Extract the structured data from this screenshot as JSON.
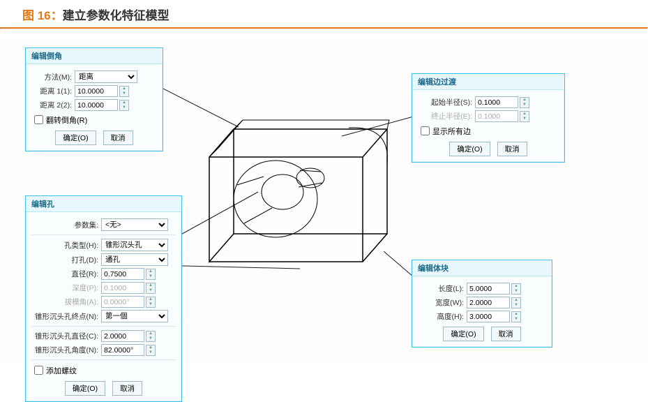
{
  "caption_prefix": "图 16：",
  "caption_text": "建立参数化特征模型",
  "chamfer": {
    "title": "编辑倒角",
    "method_label": "方法(M):",
    "method_value": "距离",
    "dist1_label": "距离 1(1):",
    "dist1_value": "10.0000",
    "dist2_label": "距离 2(2):",
    "dist2_value": "10.0000",
    "flip_label": "翻转倒角(R)",
    "ok": "确定(O)",
    "cancel": "取消"
  },
  "hole": {
    "title": "编辑孔",
    "paramset_label": "参数集:",
    "paramset_value": "<无>",
    "type_label": "孔类型(H):",
    "type_value": "锥形沉头孔",
    "drill_label": "打孔(D):",
    "drill_value": "通孔",
    "dia_label": "直径(R):",
    "dia_value": "0.7500",
    "depth_label": "深度(P):",
    "depth_value": "0.1000",
    "draft_label": "拔模角(A):",
    "draft_value": "0.0000°",
    "end_label": "锥形沉头孔终点(N):",
    "end_value": "第一個",
    "csk_dia_label": "锥形沉头孔直径(C):",
    "csk_dia_value": "2.0000",
    "csk_ang_label": "锥形沉头孔角度(N):",
    "csk_ang_value": "82.0000°",
    "thread_label": "添加螺纹",
    "ok": "确定(O)",
    "cancel": "取消"
  },
  "blend": {
    "title": "编辑边过渡",
    "start_label": "起始半径(S):",
    "start_value": "0.1000",
    "end_label": "终止半径(E):",
    "end_value": "0.1000",
    "all_label": "显示所有边",
    "ok": "确定(O)",
    "cancel": "取消"
  },
  "block": {
    "title": "编辑体块",
    "len_label": "长度(L):",
    "len_value": "5.0000",
    "wid_label": "宽度(W):",
    "wid_value": "2.0000",
    "hgt_label": "高度(H):",
    "hgt_value": "3.0000",
    "ok": "确定(O)",
    "cancel": "取消"
  }
}
